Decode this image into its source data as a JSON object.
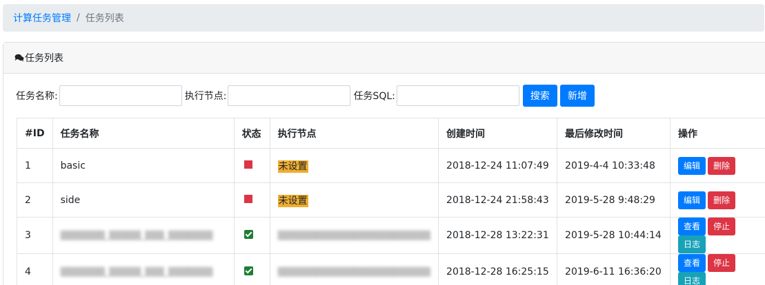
{
  "breadcrumb": {
    "root": "计算任务管理",
    "separator": "/",
    "current": "任务列表"
  },
  "card": {
    "title": "任务列表",
    "icon": "comments-icon"
  },
  "search": {
    "name_label": "任务名称:",
    "name_value": "",
    "node_label": "执行节点:",
    "node_value": "",
    "sql_label": "任务SQL:",
    "sql_value": "",
    "search_button": "搜索",
    "add_button": "新增"
  },
  "table": {
    "headers": [
      "#ID",
      "任务名称",
      "状态",
      "执行节点",
      "创建时间",
      "最后修改时间",
      "操作"
    ],
    "rows": [
      {
        "id": "1",
        "name": "basic",
        "status": "stopped",
        "node": "未设置",
        "node_blurred": false,
        "name_blurred": false,
        "created": "2018-12-24 11:07:49",
        "modified": "2019-4-4 10:33:48",
        "actions": [
          "编辑",
          "删除"
        ]
      },
      {
        "id": "2",
        "name": "side",
        "status": "stopped",
        "node": "未设置",
        "node_blurred": false,
        "name_blurred": false,
        "created": "2018-12-24 21:58:43",
        "modified": "2019-5-28 9:48:29",
        "actions": [
          "编辑",
          "删除"
        ]
      },
      {
        "id": "3",
        "name": "",
        "status": "running",
        "node": "",
        "node_blurred": true,
        "name_blurred": true,
        "created": "2018-12-28 13:22:31",
        "modified": "2019-5-28 10:44:14",
        "actions": [
          "查看",
          "停止",
          "日志"
        ]
      },
      {
        "id": "4",
        "name": "",
        "status": "running",
        "node": "",
        "node_blurred": true,
        "name_blurred": true,
        "created": "2018-12-28 16:25:15",
        "modified": "2019-6-11 16:36:20",
        "actions": [
          "查看",
          "停止",
          "日志"
        ]
      }
    ]
  },
  "colors": {
    "primary": "#007bff",
    "danger": "#dc3545",
    "info": "#17a2b8",
    "unset_highlight": "#f0ad30",
    "running": "#1e7e34"
  }
}
